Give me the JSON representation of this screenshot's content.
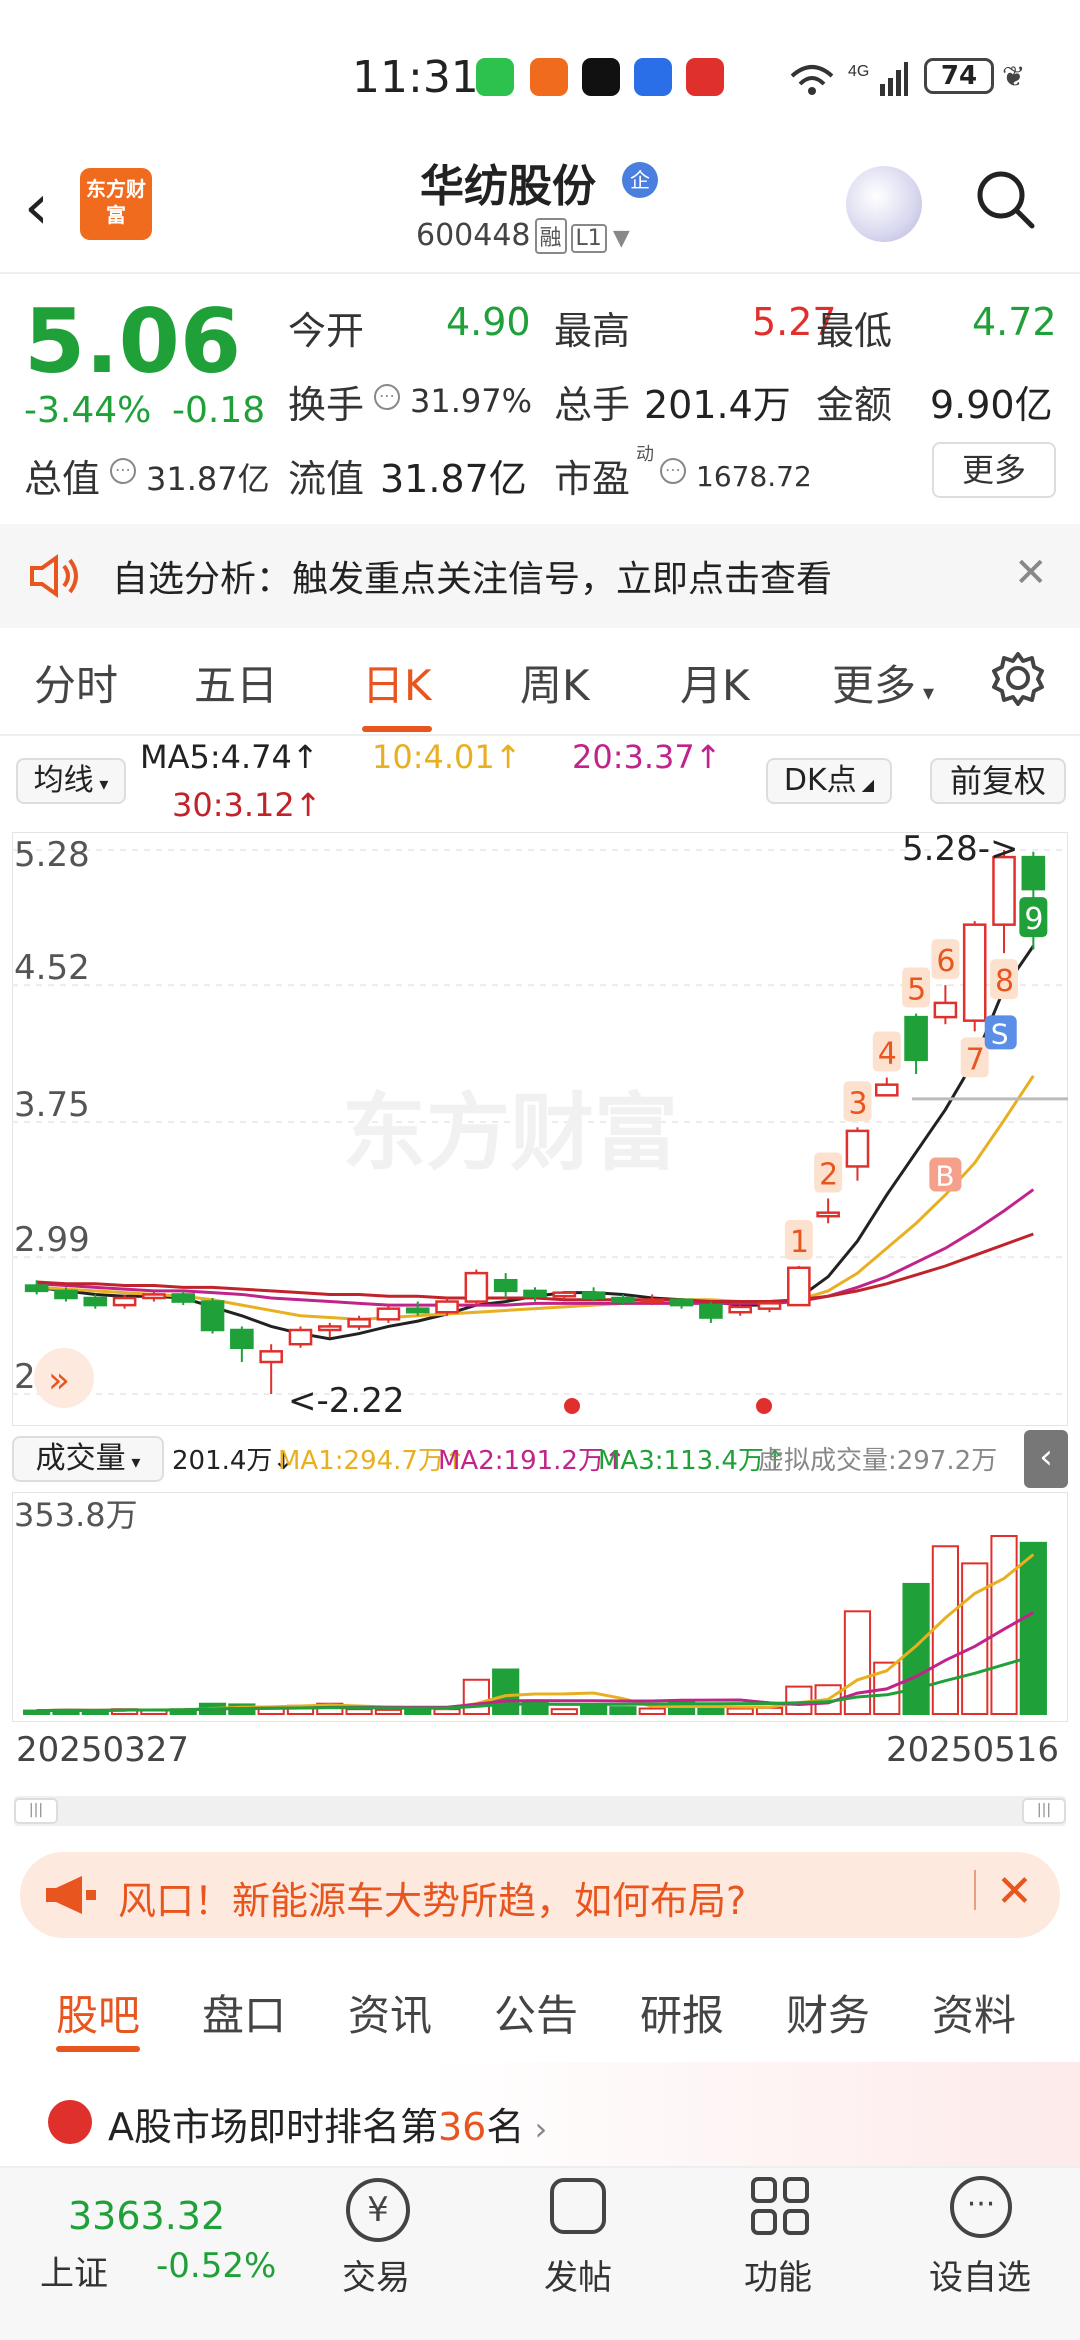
{
  "status": {
    "time": "11:31",
    "battery": "74"
  },
  "header": {
    "name": "华纺股份",
    "badge": "企",
    "code": "600448",
    "tag1": "融",
    "tag2": "L1",
    "logo": "东方财富"
  },
  "quote": {
    "price": "5.06",
    "pct": "-3.44%",
    "chg": "-0.18",
    "open_label": "今开",
    "open": "4.90",
    "high_label": "最高",
    "high": "5.27",
    "low_label": "最低",
    "low": "4.72",
    "turnover_label": "换手",
    "turnover": "31.97%",
    "vol_label": "总手",
    "vol": "201.4万",
    "amount_label": "金额",
    "amount": "9.90亿",
    "mcap_label": "总值",
    "mcap": "31.87亿",
    "float_label": "流值",
    "float": "31.87亿",
    "pe_label": "市盈",
    "pe_sup": "动",
    "pe": "1678.72",
    "more": "更多"
  },
  "alert": {
    "text": "自选分析：触发重点关注信号，立即点击查看"
  },
  "tabs": [
    "分时",
    "五日",
    "日K",
    "周K",
    "月K",
    "更多"
  ],
  "ma": {
    "btn": "均线",
    "ma5": "MA5:4.74↑",
    "ma10": "10:4.01↑",
    "ma20": "20:3.37↑",
    "ma30": "30:3.12↑",
    "dk": "DK点",
    "fq": "前复权"
  },
  "chart_data": {
    "type": "candlestick",
    "y_ticks": [
      "5.28",
      "4.52",
      "3.75",
      "2.99",
      "2.22"
    ],
    "ylim": [
      2.22,
      5.28
    ],
    "high_marker": "5.28->",
    "low_marker": "<-2.22",
    "watermark": "东方财富",
    "signals": [
      "1",
      "2",
      "3",
      "4",
      "5",
      "6",
      "7",
      "8",
      "9"
    ],
    "buy": "B",
    "sell": "S",
    "candles": [
      [
        2.83,
        2.8,
        2.86,
        2.78
      ],
      [
        2.8,
        2.76,
        2.82,
        2.74
      ],
      [
        2.76,
        2.72,
        2.78,
        2.7
      ],
      [
        2.72,
        2.76,
        2.78,
        2.7
      ],
      [
        2.76,
        2.78,
        2.8,
        2.74
      ],
      [
        2.78,
        2.74,
        2.8,
        2.72
      ],
      [
        2.74,
        2.58,
        2.76,
        2.56
      ],
      [
        2.58,
        2.48,
        2.6,
        2.4
      ],
      [
        2.4,
        2.46,
        2.5,
        2.22
      ],
      [
        2.5,
        2.58,
        2.6,
        2.48
      ],
      [
        2.58,
        2.6,
        2.62,
        2.54
      ],
      [
        2.6,
        2.64,
        2.66,
        2.58
      ],
      [
        2.64,
        2.7,
        2.72,
        2.62
      ],
      [
        2.7,
        2.68,
        2.74,
        2.66
      ],
      [
        2.68,
        2.74,
        2.76,
        2.66
      ],
      [
        2.74,
        2.9,
        2.92,
        2.72
      ],
      [
        2.86,
        2.8,
        2.9,
        2.76
      ],
      [
        2.8,
        2.77,
        2.82,
        2.74
      ],
      [
        2.77,
        2.79,
        2.8,
        2.75
      ],
      [
        2.79,
        2.76,
        2.82,
        2.74
      ],
      [
        2.76,
        2.74,
        2.78,
        2.72
      ],
      [
        2.74,
        2.75,
        2.78,
        2.72
      ],
      [
        2.75,
        2.72,
        2.76,
        2.7
      ],
      [
        2.72,
        2.65,
        2.74,
        2.62
      ],
      [
        2.68,
        2.71,
        2.72,
        2.66
      ],
      [
        2.7,
        2.73,
        2.74,
        2.68
      ],
      [
        2.72,
        2.93,
        2.94,
        2.72
      ],
      [
        3.22,
        3.24,
        3.32,
        3.18
      ],
      [
        3.5,
        3.7,
        3.72,
        3.42
      ],
      [
        3.9,
        3.96,
        4.0,
        3.9
      ],
      [
        4.34,
        4.1,
        4.36,
        4.02
      ],
      [
        4.34,
        4.42,
        4.52,
        4.3
      ],
      [
        4.32,
        4.86,
        4.88,
        4.26
      ],
      [
        4.86,
        5.24,
        5.28,
        4.7
      ],
      [
        5.24,
        5.06,
        5.27,
        4.72
      ]
    ],
    "ma": {
      "ma5": [
        2.82,
        2.8,
        2.78,
        2.77,
        2.77,
        2.76,
        2.71,
        2.66,
        2.6,
        2.56,
        2.53,
        2.56,
        2.6,
        2.63,
        2.67,
        2.72,
        2.74,
        2.77,
        2.79,
        2.79,
        2.78,
        2.76,
        2.75,
        2.74,
        2.72,
        2.72,
        2.76,
        2.88,
        3.08,
        3.34,
        3.58,
        3.82,
        4.1,
        4.5,
        4.74
      ],
      "ma10": [
        2.82,
        2.81,
        2.8,
        2.79,
        2.78,
        2.77,
        2.75,
        2.72,
        2.69,
        2.66,
        2.65,
        2.64,
        2.65,
        2.66,
        2.67,
        2.68,
        2.69,
        2.7,
        2.71,
        2.72,
        2.73,
        2.74,
        2.75,
        2.75,
        2.74,
        2.74,
        2.75,
        2.8,
        2.9,
        3.04,
        3.18,
        3.34,
        3.52,
        3.76,
        4.01
      ],
      "ma20": [
        2.84,
        2.83,
        2.82,
        2.81,
        2.8,
        2.8,
        2.79,
        2.78,
        2.76,
        2.75,
        2.74,
        2.73,
        2.72,
        2.72,
        2.72,
        2.72,
        2.72,
        2.73,
        2.73,
        2.73,
        2.73,
        2.73,
        2.73,
        2.73,
        2.73,
        2.73,
        2.74,
        2.77,
        2.82,
        2.88,
        2.96,
        3.04,
        3.14,
        3.25,
        3.37
      ],
      "ma30": [
        2.85,
        2.84,
        2.84,
        2.83,
        2.83,
        2.82,
        2.82,
        2.81,
        2.8,
        2.79,
        2.78,
        2.78,
        2.77,
        2.77,
        2.76,
        2.76,
        2.76,
        2.76,
        2.75,
        2.75,
        2.75,
        2.75,
        2.75,
        2.74,
        2.74,
        2.74,
        2.75,
        2.77,
        2.8,
        2.84,
        2.89,
        2.94,
        3.0,
        3.06,
        3.12
      ]
    },
    "volume_label": "成交量",
    "volume_max": "353.8万",
    "volumes": [
      10,
      12,
      10,
      14,
      12,
      14,
      30,
      28,
      20,
      24,
      30,
      14,
      12,
      12,
      14,
      100,
      130,
      36,
      14,
      26,
      20,
      16,
      34,
      16,
      16,
      18,
      80,
      84,
      300,
      150,
      380,
      490,
      440,
      520,
      500
    ],
    "x_start": "20250327",
    "x_end": "20250516"
  },
  "volume": {
    "label": "成交量",
    "vol": "201.4万↓",
    "ma1": "MA1:294.7万↑",
    "ma2": "MA2:191.2万↑",
    "ma3": "MA3:113.4万↑",
    "virt": "虚拟成交量:297.2万"
  },
  "promo": {
    "text": "风口！新能源车大势所趋，如何布局?"
  },
  "btabs": [
    "股吧",
    "盘口",
    "资讯",
    "公告",
    "研报",
    "财务",
    "资料"
  ],
  "rank": {
    "pre": "A股市场即时排名第",
    "num": "36",
    "post": "名"
  },
  "bottom": {
    "index": "3363.32",
    "index_name": "上证",
    "index_chg": "-0.52%",
    "trade": "交易",
    "post": "发帖",
    "func": "功能",
    "watch": "设自选"
  },
  "colors": {
    "up": "#e0302c",
    "down": "#1fa038",
    "accent": "#e8551f"
  }
}
